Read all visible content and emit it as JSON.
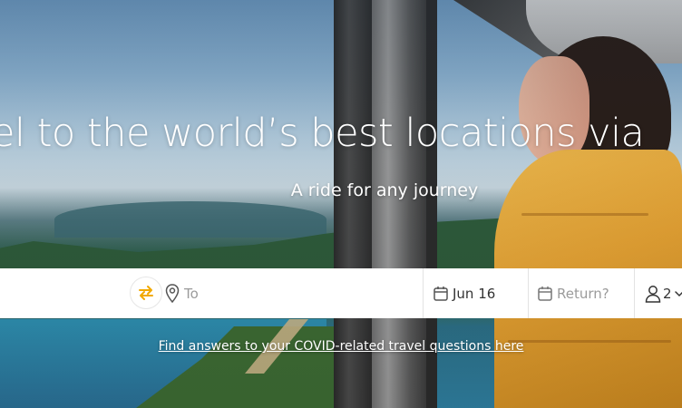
{
  "hero": {
    "headline": "el to the world’s best locations via",
    "subhead": "A ride for any journey"
  },
  "search": {
    "to_placeholder": "To",
    "depart_date": "Jun 16",
    "return_placeholder": "Return?",
    "passengers": "2"
  },
  "links": {
    "covid": "Find answers to your COVID-related travel questions here"
  },
  "colors": {
    "accent": "#f2a900",
    "icon_gray": "#555555",
    "placeholder": "#9b9b9b"
  },
  "icons": {
    "swap": "swap-arrows-icon",
    "location": "map-pin-icon",
    "calendar": "calendar-icon",
    "passenger": "person-icon",
    "dropdown": "chevron-down-icon"
  }
}
